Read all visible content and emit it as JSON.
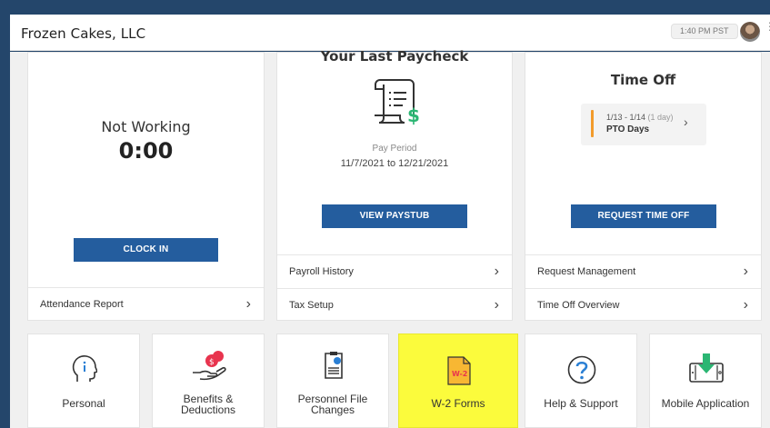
{
  "header": {
    "company_name": "Frozen Cakes, LLC",
    "time": "1:40 PM PST"
  },
  "clock_card": {
    "status": "Not Working",
    "hours": "0:00",
    "button": "CLOCK IN",
    "link": "Attendance Report"
  },
  "paycheck_card": {
    "title": "Your Last Paycheck",
    "period_label": "Pay Period",
    "period_range": "11/7/2021 to 12/21/2021",
    "button": "VIEW PAYSTUB",
    "links": [
      "Payroll History",
      "Tax Setup"
    ]
  },
  "timeoff_card": {
    "title": "Time Off",
    "entry_dates": "1/13 - 1/14",
    "entry_duration": "(1 day)",
    "entry_type": "PTO Days",
    "button": "REQUEST TIME OFF",
    "links": [
      "Request Management",
      "Time Off Overview"
    ]
  },
  "tiles": [
    {
      "label": "Personal",
      "icon": "personal-head-icon"
    },
    {
      "label": "Benefits & Deductions",
      "icon": "benefits-hand-icon"
    },
    {
      "label": "Personnel File Changes",
      "icon": "file-changes-icon"
    },
    {
      "label": "W-2 Forms",
      "icon": "w2-document-icon",
      "highlight": "#fbfb3c"
    },
    {
      "label": "Help & Support",
      "icon": "help-question-icon"
    },
    {
      "label": "Mobile Application",
      "icon": "mobile-download-icon"
    }
  ],
  "tile_extra": {
    "w2_text": "W-2"
  },
  "colors": {
    "primary_button": "#245d9e",
    "frame": "#24466b",
    "accent_orange": "#f29b2b",
    "icon_green": "#2bb673",
    "icon_red": "#e8344e"
  }
}
